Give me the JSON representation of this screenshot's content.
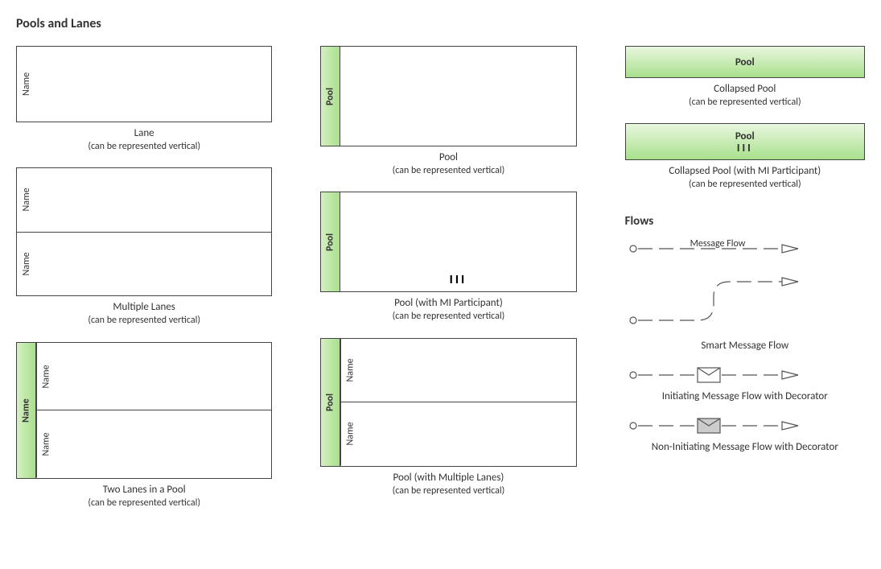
{
  "title": "Pools and Lanes",
  "vertical_note": "(can be represented vertical)",
  "col1": {
    "lane": {
      "label": "Name",
      "title": "Lane"
    },
    "mlanes": {
      "label1": "Name",
      "label2": "Name",
      "title": "Multiple Lanes"
    },
    "twolanes": {
      "pool": "Name",
      "lane1": "Name",
      "lane2": "Name",
      "title": "Two Lanes in a Pool"
    }
  },
  "col2": {
    "pool": {
      "label": "Pool",
      "title": "Pool"
    },
    "poolmi": {
      "label": "Pool",
      "title": "Pool (with MI Participant)",
      "mi": "III"
    },
    "poolml": {
      "label": "Pool",
      "lane1": "Name",
      "lane2": "Name",
      "title": "Pool (with Multiple Lanes)"
    }
  },
  "col3": {
    "cpool": {
      "label": "Pool",
      "title": "Collapsed Pool"
    },
    "cpoolmi": {
      "label": "Pool",
      "title": "Collapsed Pool (with MI Participant)",
      "mi": "III"
    },
    "flows_title": "Flows",
    "flow1": {
      "title": "Message Flow"
    },
    "flow2": {
      "title": "Smart Message Flow"
    },
    "flow3": {
      "title": "Initiating Message Flow with Decorator"
    },
    "flow4": {
      "title": "Non-Initiating Message Flow with Decorator"
    }
  }
}
